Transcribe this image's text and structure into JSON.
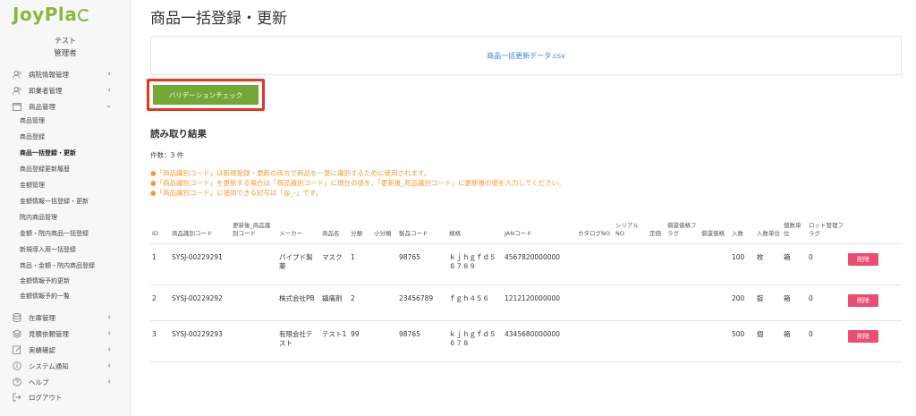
{
  "app": {
    "logo": "JoyPla",
    "user_line1": "テスト",
    "user_line2": "管理者"
  },
  "sidebar": {
    "sections": [
      {
        "label": "病院情報管理",
        "icon": "users-icon"
      },
      {
        "label": "卸業者管理",
        "icon": "users-icon"
      },
      {
        "label": "商品管理",
        "icon": "box-icon"
      }
    ],
    "sub_items": [
      "商品管理",
      "商品登録",
      "商品一括登録・更新",
      "商品登録更新履歴",
      "金額管理",
      "金額情報一括登録・更新",
      "院内商品管理",
      "金額・院内商品一括登録",
      "新規導入用一括登録",
      "商品・金額・院内商品登録",
      "金額情報予約更新",
      "金額情報予約一覧"
    ],
    "bottom_sections": [
      {
        "label": "在庫管理",
        "icon": "database-icon"
      },
      {
        "label": "見積依頼管理",
        "icon": "stack-icon"
      },
      {
        "label": "実績確認",
        "icon": "edit-icon"
      },
      {
        "label": "システム通知",
        "icon": "info-icon"
      },
      {
        "label": "ヘルプ",
        "icon": "help-icon"
      },
      {
        "label": "ログアウト",
        "icon": "logout-icon"
      }
    ]
  },
  "main": {
    "title": "商品一括登録・更新",
    "csv_link": "商品一括更新データ.csv",
    "validate_label": "バリデーションチェック",
    "section_title": "読み取り結果",
    "count": "件数：3 件",
    "notes": [
      "●「商品識別コード」は新規登録・更新の両方で商品を一意に識別するために使用されます。",
      "●「商品識別コード」を更新する場合は「商品識別コード」に現在の値を、「更新後_商品識別コード」に更新後の値を入力してください。",
      "●「商品識別コード」に使用できる記号は「@_-」です。"
    ]
  },
  "table": {
    "headers": [
      "ID",
      "商品識別コード",
      "更新後_商品識別コード",
      "メーカー",
      "商品名",
      "分類",
      "小分類",
      "製品コード",
      "規格",
      "JANコード",
      "カタログNO",
      "シリアルNO",
      "定価",
      "償還価格フラグ",
      "償還価格",
      "入数",
      "入数単位",
      "個数単位",
      "ロット管理フラグ",
      ""
    ],
    "rows": [
      {
        "id": "1",
        "code": "SYSJ-00229291",
        "new_code": "",
        "maker": "パイプド製薬",
        "name": "マスク",
        "cat": "1",
        "subcat": "",
        "product_code": "98765",
        "spec": "ｋｊｈｇｆｄ５６７８９",
        "jan": "4567820000000",
        "catalog": "",
        "serial": "",
        "price": "",
        "flag": "",
        "refund": "",
        "qty": "100",
        "qty_unit": "枚",
        "unit": "箱",
        "lot": "0",
        "delete": "削除"
      },
      {
        "id": "2",
        "code": "SYSJ-00229292",
        "new_code": "",
        "maker": "株式会社PB",
        "name": "鎮痛剤",
        "cat": "2",
        "subcat": "",
        "product_code": "23456789",
        "spec": "ｆｇｈ４５６",
        "jan": "1212120000000",
        "catalog": "",
        "serial": "",
        "price": "",
        "flag": "",
        "refund": "",
        "qty": "200",
        "qty_unit": "錠",
        "unit": "箱",
        "lot": "0",
        "delete": "削除"
      },
      {
        "id": "3",
        "code": "SYSJ-00229293",
        "new_code": "",
        "maker": "有限会社テスト",
        "name": "テスト1",
        "cat": "99",
        "subcat": "",
        "product_code": "98765",
        "spec": "ｋｊｈｇｆｄ５６７８",
        "jan": "4345680000000",
        "catalog": "",
        "serial": "",
        "price": "",
        "flag": "",
        "refund": "",
        "qty": "500",
        "qty_unit": "個",
        "unit": "箱",
        "lot": "0",
        "delete": "削除"
      }
    ]
  }
}
